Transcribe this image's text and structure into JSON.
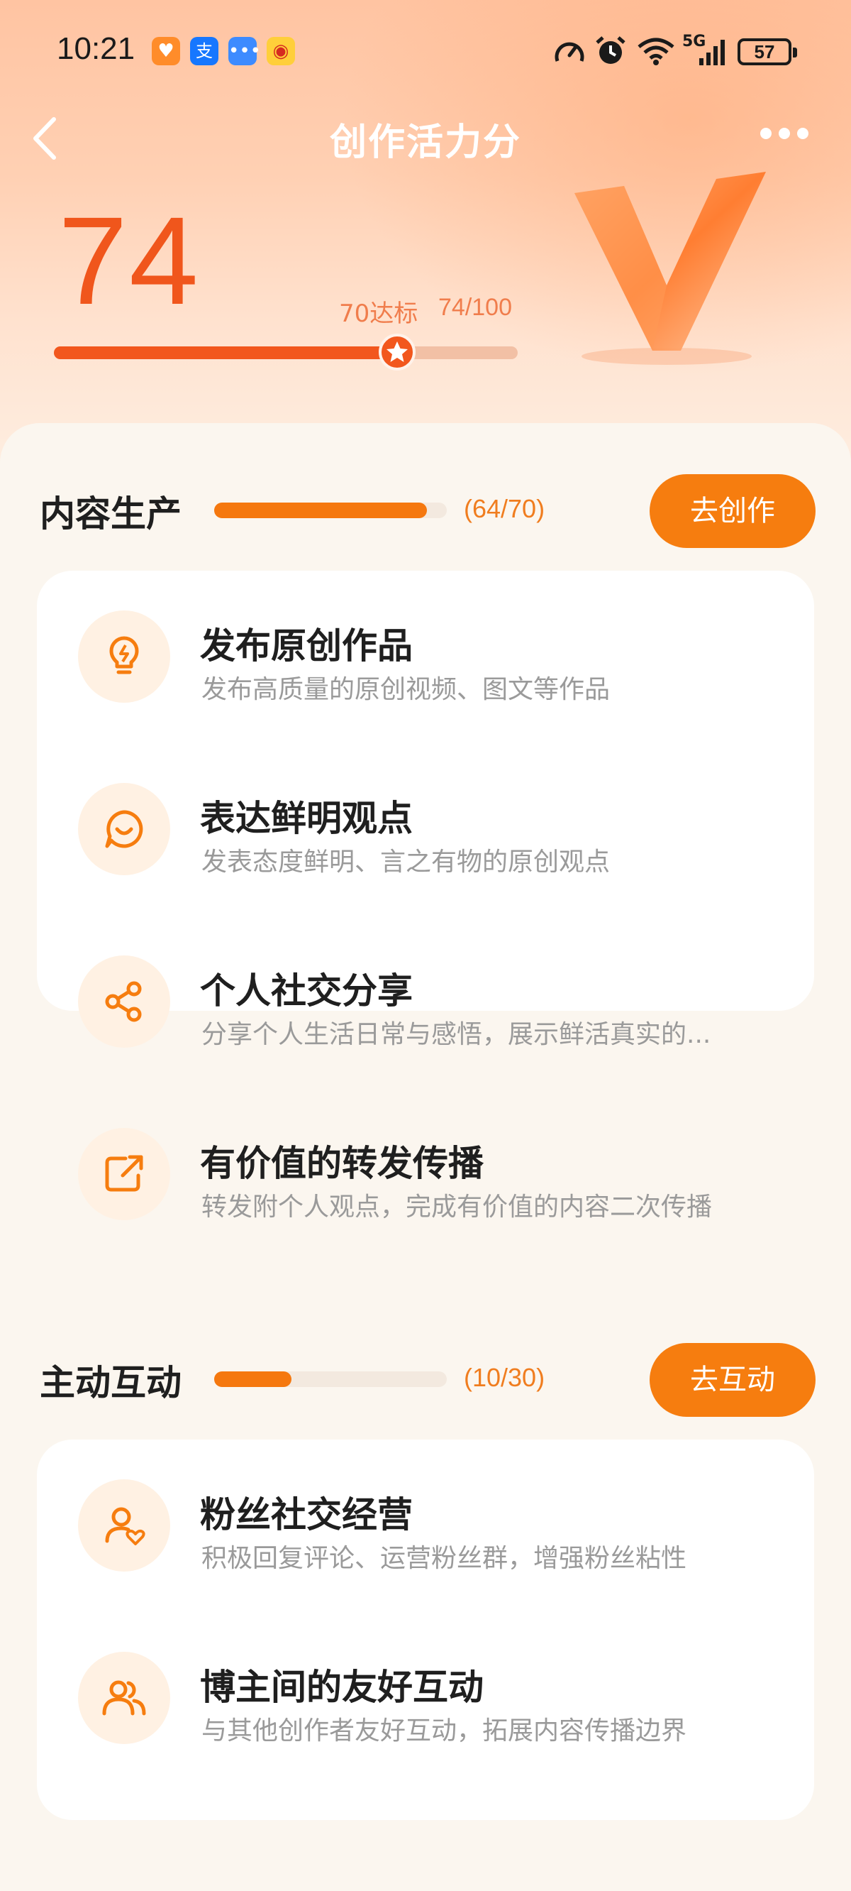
{
  "status_bar": {
    "time": "10:21",
    "battery": "57",
    "network": "5G"
  },
  "nav": {
    "title": "创作活力分"
  },
  "score": {
    "value": "74",
    "target_label": "70达标",
    "progress_text": "74/100",
    "progress_fraction": 0.74
  },
  "sections": [
    {
      "title": "内容生产",
      "count": "(64/70)",
      "fraction": 0.914,
      "button": "去创作",
      "items": [
        {
          "icon": "lightbulb-icon",
          "title": "发布原创作品",
          "desc": "发布高质量的原创视频、图文等作品"
        },
        {
          "icon": "smile-bubble-icon",
          "title": "表达鲜明观点",
          "desc": "发表态度鲜明、言之有物的原创观点"
        },
        {
          "icon": "share-icon",
          "title": "个人社交分享",
          "desc": "分享个人生活日常与感悟，展示鲜活真实的..."
        },
        {
          "icon": "forward-icon",
          "title": "有价值的转发传播",
          "desc": "转发附个人观点，完成有价值的内容二次传播"
        }
      ]
    },
    {
      "title": "主动互动",
      "count": "(10/30)",
      "fraction": 0.333,
      "button": "去互动",
      "items": [
        {
          "icon": "user-heart-icon",
          "title": "粉丝社交经营",
          "desc": "积极回复评论、运营粉丝群，增强粉丝粘性"
        },
        {
          "icon": "users-icon",
          "title": "博主间的友好互动",
          "desc": "与其他创作者友好互动，拓展内容传播边界"
        }
      ]
    }
  ],
  "colors": {
    "accent": "#f67d0f",
    "score": "#f0561c",
    "muted_text": "#9a9a9a"
  }
}
